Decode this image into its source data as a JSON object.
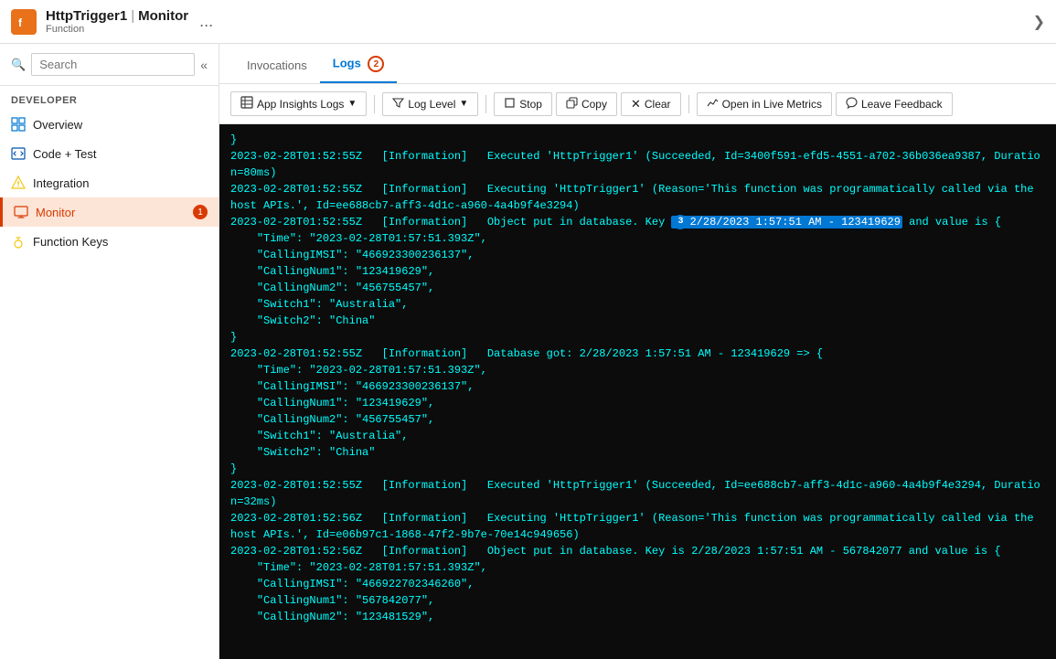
{
  "header": {
    "icon_label": "function-app-icon",
    "title": "HttpTrigger1",
    "separator": "|",
    "page": "Monitor",
    "subtitle": "Function",
    "dots_label": "...",
    "expand_label": "❯"
  },
  "sidebar": {
    "search_placeholder": "Search",
    "collapse_icon": "«",
    "section_label": "Developer",
    "items": [
      {
        "id": "overview",
        "label": "Overview",
        "icon": "≡"
      },
      {
        "id": "code-test",
        "label": "Code + Test",
        "icon": "💻"
      },
      {
        "id": "integration",
        "label": "Integration",
        "icon": "⚡"
      },
      {
        "id": "monitor",
        "label": "Monitor",
        "icon": "🔲",
        "active": true,
        "badge": "1"
      },
      {
        "id": "function-keys",
        "label": "Function Keys",
        "icon": "🔑"
      }
    ]
  },
  "tabs": [
    {
      "id": "invocations",
      "label": "Invocations",
      "active": false
    },
    {
      "id": "logs",
      "label": "Logs",
      "active": true,
      "badge": "2"
    }
  ],
  "toolbar": {
    "app_insights_logs": "App Insights Logs",
    "log_level": "Log Level",
    "stop": "Stop",
    "copy": "Copy",
    "clear": "Clear",
    "open_live_metrics": "Open in Live Metrics",
    "leave_feedback": "Leave Feedback"
  },
  "log_content": [
    {
      "type": "line",
      "text": "}"
    },
    {
      "type": "line",
      "text": "2023-02-28T01:52:55Z   [Information]   Executed 'HttpTrigger1' (Succeeded, Id=3400f591-efd5-4551-a702-36b036ea9387, Duration=80ms)"
    },
    {
      "type": "line",
      "text": "2023-02-28T01:52:55Z   [Information]   Executing 'HttpTrigger1' (Reason='This function was programmatically called via the host APIs.', Id=ee688cb7-aff3-4d1c-a960-4a4b9f4e3294)"
    },
    {
      "type": "line",
      "text": "2023-02-28T01:52:55Z   [Information]   Object put in database. Key ",
      "highlight": "2/28/2023 1:57:51 AM - 123419629",
      "text_after": " and value is {"
    },
    {
      "type": "json",
      "lines": [
        "    \"Time\": \"2023-02-28T01:57:51.393Z\",",
        "    \"CallingIMSI\": \"466923300236137\",",
        "    \"CallingNum1\": \"123419629\",",
        "    \"CallingNum2\": \"456755457\",",
        "    \"Switch1\": \"Australia\",",
        "    \"Switch2\": \"China\""
      ]
    },
    {
      "type": "line",
      "text": "}"
    },
    {
      "type": "line",
      "text": "2023-02-28T01:52:55Z   [Information]   Database got: 2/28/2023 1:57:51 AM - 123419629 => {"
    },
    {
      "type": "json",
      "lines": [
        "    \"Time\": \"2023-02-28T01:57:51.393Z\",",
        "    \"CallingIMSI\": \"466923300236137\",",
        "    \"CallingNum1\": \"123419629\",",
        "    \"CallingNum2\": \"456755457\",",
        "    \"Switch1\": \"Australia\",",
        "    \"Switch2\": \"China\""
      ]
    },
    {
      "type": "line",
      "text": "}"
    },
    {
      "type": "line",
      "text": "2023-02-28T01:52:55Z   [Information]   Executed 'HttpTrigger1' (Succeeded, Id=ee688cb7-aff3-4d1c-a960-4a4b9f4e3294, Duration=32ms)"
    },
    {
      "type": "line",
      "text": "2023-02-28T01:52:56Z   [Information]   Executing 'HttpTrigger1' (Reason='This function was programmatically called via the host APIs.', Id=e06b97c1-1868-47f2-9b7e-70e14c949656)"
    },
    {
      "type": "line",
      "text": "2023-02-28T01:52:56Z   [Information]   Object put in database. Key is 2/28/2023 1:57:51 AM - 567842077 and value is {"
    },
    {
      "type": "json",
      "lines": [
        "    \"Time\": \"2023-02-28T01:57:51.393Z\",",
        "    \"CallingIMSI\": \"466922702346260\",",
        "    \"CallingNum1\": \"567842077\",",
        "    \"CallingNum2\": \"123481529\","
      ]
    }
  ]
}
